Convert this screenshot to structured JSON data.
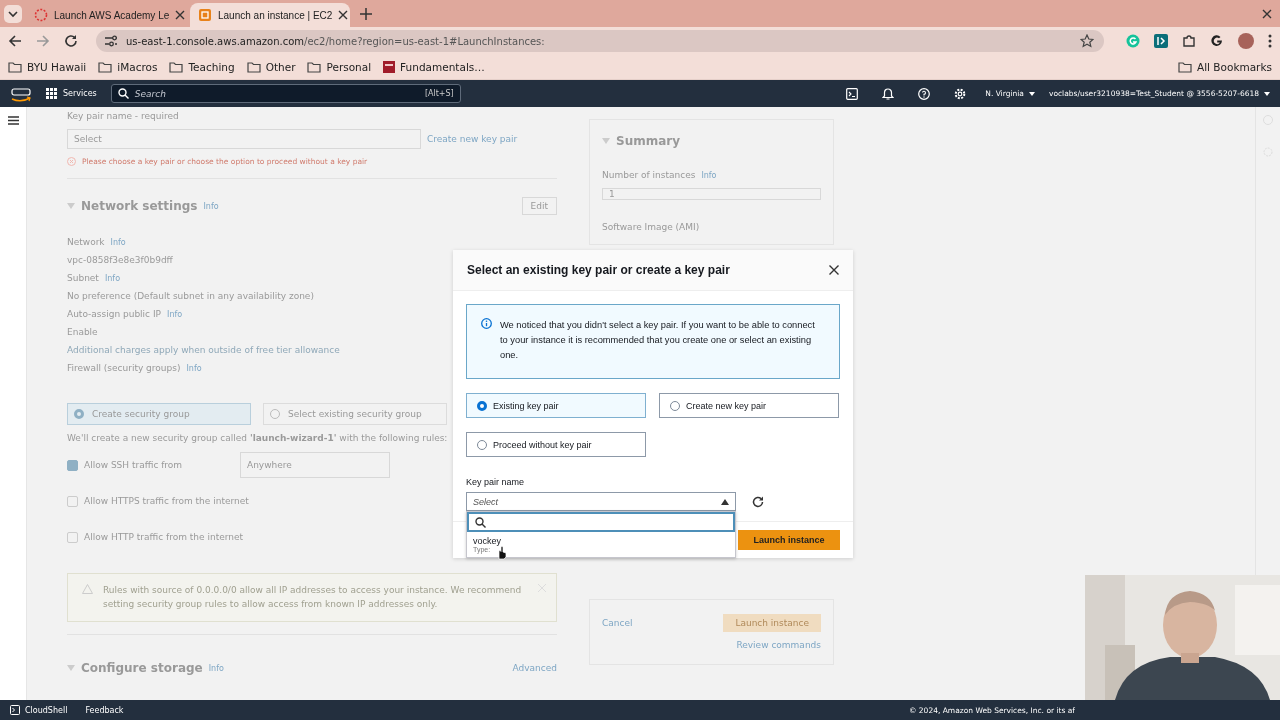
{
  "browser": {
    "tabs": [
      {
        "title": "Launch AWS Academy Le",
        "kind": "academy",
        "selected": false
      },
      {
        "title": "Launch an instance | EC2",
        "kind": "aws",
        "selected": true
      }
    ],
    "url_host": "us-east-1.console.aws.amazon.com",
    "url_path": "/ec2/home?region=us-east-1#LaunchInstances:",
    "bookmarks": [
      {
        "label": "BYU Hawaii",
        "kind": "folder"
      },
      {
        "label": "iMacros",
        "kind": "folder"
      },
      {
        "label": "Teaching",
        "kind": "folder"
      },
      {
        "label": "Other",
        "kind": "folder"
      },
      {
        "label": "Personal",
        "kind": "folder"
      },
      {
        "label": "Fundamentals…",
        "kind": "site"
      }
    ],
    "all_bookmarks": "All Bookmarks"
  },
  "console_header": {
    "services": "Services",
    "search_placeholder": "Search",
    "shortcut": "[Alt+S]",
    "region": "N. Virginia",
    "account": "voclabs/user3210938=Test_Student @ 3556-5207-6618"
  },
  "background": {
    "key_pair": {
      "label": "Key pair name - required",
      "value": "Select",
      "link": "Create new key pair",
      "error": "Please choose a key pair or choose the option to proceed without a key pair"
    },
    "network": {
      "title": "Network settings",
      "info": "Info",
      "edit": "Edit",
      "fields": [
        {
          "label": "Network",
          "info": "Info",
          "value": "vpc-0858f3e8e3f0b9dff"
        },
        {
          "label": "Subnet",
          "info": "Info",
          "value": "No preference (Default subnet in any availability zone)"
        },
        {
          "label": "Auto-assign public IP",
          "info": "Info",
          "value": "Enable"
        }
      ],
      "note": "Additional charges apply when outside of free tier allowance",
      "firewall": "Firewall (security groups)",
      "firewall_info": "Info",
      "firewall_options": [
        {
          "label": "Create security group",
          "selected": true
        },
        {
          "label": "Select existing security group",
          "selected": false
        }
      ],
      "sentence": "We'll create a new security group called **'launch-wizard-1'** with the following rules:",
      "rules": [
        {
          "label": "Allow SSH traffic from",
          "checked": true,
          "source": "Anywhere"
        },
        {
          "label": "Allow HTTPS traffic from the internet",
          "checked": false
        },
        {
          "label": "Allow HTTP traffic from the internet",
          "checked": false
        }
      ],
      "warning": "Rules with source of 0.0.0.0/0 allow all IP addresses to access your instance. We recommend setting security group rules to allow access from known IP addresses only."
    },
    "storage": {
      "title": "Configure storage",
      "info": "Info",
      "advanced": "Advanced"
    },
    "summary": {
      "title": "Summary",
      "instances_label": "Number of instances",
      "instances_info": "Info",
      "instances_value": "1",
      "ami_label": "Software Image (AMI)",
      "cancel": "Cancel",
      "launch": "Launch instance",
      "review": "Review commands"
    }
  },
  "modal": {
    "title": "Select an existing key pair or create a key pair",
    "notice": "We noticed that you didn't select a key pair. If you want to be able to connect to your instance it is recommended that you create one or select an existing one.",
    "options": [
      {
        "label": "Existing key pair",
        "selected": true
      },
      {
        "label": "Create new key pair",
        "selected": false
      },
      {
        "label": "Proceed without key pair",
        "selected": false
      }
    ],
    "field_label": "Key pair name",
    "select_placeholder": "Select",
    "expanded": true,
    "dropdown_items": [
      {
        "name": "vockey",
        "detail": "Type:"
      }
    ],
    "primary_button": "Launch instance"
  },
  "footer": {
    "links": [
      "CloudShell",
      "Feedback"
    ],
    "copyright": "© 2024, Amazon Web Services, Inc. or its af"
  }
}
